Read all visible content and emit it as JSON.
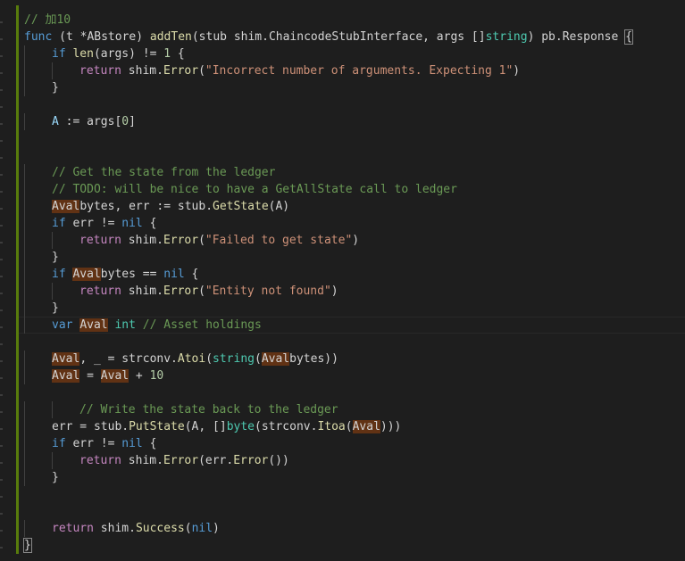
{
  "editor": {
    "lines": [
      {
        "indent": 0,
        "tokens": [
          {
            "t": "// 加10",
            "c": "cm"
          }
        ]
      },
      {
        "indent": 0,
        "tokens": [
          {
            "t": "func",
            "c": "kw"
          },
          {
            "t": " (t *ABstore) "
          },
          {
            "t": "addTen",
            "c": "fn"
          },
          {
            "t": "(stub shim.ChaincodeStubInterface, args []"
          },
          {
            "t": "string",
            "c": "ty"
          },
          {
            "t": ") pb.Response "
          },
          {
            "t": "{",
            "c": "bracket"
          }
        ]
      },
      {
        "indent": 1,
        "tokens": [
          {
            "t": "if",
            "c": "kw"
          },
          {
            "t": " "
          },
          {
            "t": "len",
            "c": "fn"
          },
          {
            "t": "(args) != "
          },
          {
            "t": "1",
            "c": "num"
          },
          {
            "t": " {"
          }
        ]
      },
      {
        "indent": 2,
        "tokens": [
          {
            "t": "return",
            "c": "ctl"
          },
          {
            "t": " shim."
          },
          {
            "t": "Error",
            "c": "fn"
          },
          {
            "t": "("
          },
          {
            "t": "\"Incorrect number of arguments. Expecting 1\"",
            "c": "str"
          },
          {
            "t": ")"
          }
        ]
      },
      {
        "indent": 1,
        "tokens": [
          {
            "t": "}"
          }
        ]
      },
      {
        "indent": 0,
        "tokens": []
      },
      {
        "indent": 1,
        "tokens": [
          {
            "t": "A",
            "c": "var"
          },
          {
            "t": " := args["
          },
          {
            "t": "0",
            "c": "num"
          },
          {
            "t": "]"
          }
        ]
      },
      {
        "indent": 0,
        "tokens": []
      },
      {
        "indent": 0,
        "tokens": []
      },
      {
        "indent": 1,
        "tokens": [
          {
            "t": "// Get the state from the ledger",
            "c": "cm"
          }
        ]
      },
      {
        "indent": 1,
        "tokens": [
          {
            "t": "// TODO: will be nice to have a GetAllState call to ledger",
            "c": "cm"
          }
        ]
      },
      {
        "indent": 1,
        "tokens": [
          {
            "t": "Aval",
            "c": "hl"
          },
          {
            "t": "bytes, err := stub."
          },
          {
            "t": "GetState",
            "c": "fn"
          },
          {
            "t": "(A)"
          }
        ]
      },
      {
        "indent": 1,
        "tokens": [
          {
            "t": "if",
            "c": "kw"
          },
          {
            "t": " err != "
          },
          {
            "t": "nil",
            "c": "kw"
          },
          {
            "t": " {"
          }
        ]
      },
      {
        "indent": 2,
        "tokens": [
          {
            "t": "return",
            "c": "ctl"
          },
          {
            "t": " shim."
          },
          {
            "t": "Error",
            "c": "fn"
          },
          {
            "t": "("
          },
          {
            "t": "\"Failed to get state\"",
            "c": "str"
          },
          {
            "t": ")"
          }
        ]
      },
      {
        "indent": 1,
        "tokens": [
          {
            "t": "}"
          }
        ]
      },
      {
        "indent": 1,
        "tokens": [
          {
            "t": "if",
            "c": "kw"
          },
          {
            "t": " "
          },
          {
            "t": "Aval",
            "c": "hl"
          },
          {
            "t": "bytes == "
          },
          {
            "t": "nil",
            "c": "kw"
          },
          {
            "t": " {"
          }
        ]
      },
      {
        "indent": 2,
        "tokens": [
          {
            "t": "return",
            "c": "ctl"
          },
          {
            "t": " shim."
          },
          {
            "t": "Error",
            "c": "fn"
          },
          {
            "t": "("
          },
          {
            "t": "\"Entity not found\"",
            "c": "str"
          },
          {
            "t": ")"
          }
        ]
      },
      {
        "indent": 1,
        "tokens": [
          {
            "t": "}"
          }
        ]
      },
      {
        "indent": 1,
        "current": true,
        "tokens": [
          {
            "t": "var",
            "c": "kw"
          },
          {
            "t": " "
          },
          {
            "t": "Aval",
            "c": "hl"
          },
          {
            "t": " "
          },
          {
            "t": "int",
            "c": "ty"
          },
          {
            "t": " "
          },
          {
            "t": "// Asset holdings",
            "c": "cm"
          }
        ]
      },
      {
        "indent": 0,
        "tokens": []
      },
      {
        "indent": 1,
        "tokens": [
          {
            "t": "Aval",
            "c": "hl"
          },
          {
            "t": ", _ = strconv."
          },
          {
            "t": "Atoi",
            "c": "fn"
          },
          {
            "t": "("
          },
          {
            "t": "string",
            "c": "ty"
          },
          {
            "t": "("
          },
          {
            "t": "Aval",
            "c": "hl"
          },
          {
            "t": "bytes))"
          }
        ]
      },
      {
        "indent": 1,
        "tokens": [
          {
            "t": "Aval",
            "c": "hl"
          },
          {
            "t": " = "
          },
          {
            "t": "Aval",
            "c": "hl"
          },
          {
            "t": " + "
          },
          {
            "t": "10",
            "c": "num"
          }
        ]
      },
      {
        "indent": 0,
        "tokens": []
      },
      {
        "indent": 2,
        "tokens": [
          {
            "t": "// Write the state back to the ledger",
            "c": "cm"
          }
        ]
      },
      {
        "indent": 1,
        "tokens": [
          {
            "t": "err = stub."
          },
          {
            "t": "PutState",
            "c": "fn"
          },
          {
            "t": "(A, []"
          },
          {
            "t": "byte",
            "c": "ty"
          },
          {
            "t": "(strconv."
          },
          {
            "t": "Itoa",
            "c": "fn"
          },
          {
            "t": "("
          },
          {
            "t": "Aval",
            "c": "hl"
          },
          {
            "t": ")))"
          }
        ]
      },
      {
        "indent": 1,
        "tokens": [
          {
            "t": "if",
            "c": "kw"
          },
          {
            "t": " err != "
          },
          {
            "t": "nil",
            "c": "kw"
          },
          {
            "t": " {"
          }
        ]
      },
      {
        "indent": 2,
        "tokens": [
          {
            "t": "return",
            "c": "ctl"
          },
          {
            "t": " shim."
          },
          {
            "t": "Error",
            "c": "fn"
          },
          {
            "t": "(err."
          },
          {
            "t": "Error",
            "c": "fn"
          },
          {
            "t": "())"
          }
        ]
      },
      {
        "indent": 1,
        "tokens": [
          {
            "t": "}"
          }
        ]
      },
      {
        "indent": 0,
        "tokens": []
      },
      {
        "indent": 0,
        "tokens": []
      },
      {
        "indent": 1,
        "tokens": [
          {
            "t": "return",
            "c": "ctl"
          },
          {
            "t": " shim."
          },
          {
            "t": "Success",
            "c": "fn"
          },
          {
            "t": "("
          },
          {
            "t": "nil",
            "c": "kw"
          },
          {
            "t": ")"
          }
        ]
      },
      {
        "indent": 0,
        "tokens": [
          {
            "t": "}",
            "c": "bracket"
          }
        ]
      }
    ]
  }
}
